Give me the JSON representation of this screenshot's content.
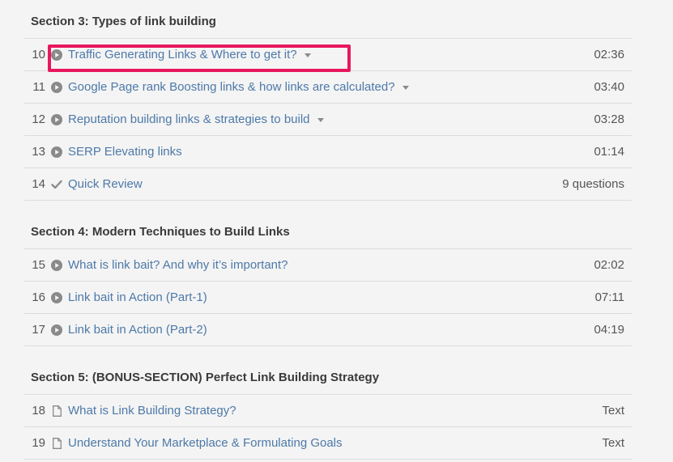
{
  "sections": [
    {
      "title": "Section 3: Types of link building",
      "items": [
        {
          "num": "10",
          "icon": "play-icon",
          "title": "Traffic Generating Links & Where to get it?",
          "caret": true,
          "duration": "02:36",
          "highlighted": true
        },
        {
          "num": "11",
          "icon": "play-icon",
          "title": "Google Page rank Boosting links & how links are calculated?",
          "caret": true,
          "duration": "03:40"
        },
        {
          "num": "12",
          "icon": "play-icon",
          "title": "Reputation building links & strategies to build",
          "caret": true,
          "duration": "03:28"
        },
        {
          "num": "13",
          "icon": "play-icon",
          "title": "SERP Elevating links",
          "caret": false,
          "duration": "01:14"
        },
        {
          "num": "14",
          "icon": "check-icon",
          "title": "Quick Review",
          "caret": false,
          "duration": "9 questions"
        }
      ]
    },
    {
      "title": "Section 4: Modern Techniques to Build Links",
      "items": [
        {
          "num": "15",
          "icon": "play-icon",
          "title": "What is link bait? And why it’s important?",
          "caret": false,
          "duration": "02:02"
        },
        {
          "num": "16",
          "icon": "play-icon",
          "title": "Link bait in Action (Part-1)",
          "caret": false,
          "duration": "07:11"
        },
        {
          "num": "17",
          "icon": "play-icon",
          "title": "Link bait in Action (Part-2)",
          "caret": false,
          "duration": "04:19"
        }
      ]
    },
    {
      "title": "Section 5: (BONUS-SECTION) Perfect Link Building Strategy",
      "items": [
        {
          "num": "18",
          "icon": "document-icon",
          "title": "What is Link Building Strategy?",
          "caret": false,
          "duration": "Text"
        },
        {
          "num": "19",
          "icon": "document-icon",
          "title": "Understand Your Marketplace & Formulating Goals",
          "caret": false,
          "duration": "Text"
        }
      ]
    }
  ],
  "colors": {
    "link": "#4d79a8",
    "highlight": "#e8185d",
    "icon": "#8a8a8a"
  }
}
